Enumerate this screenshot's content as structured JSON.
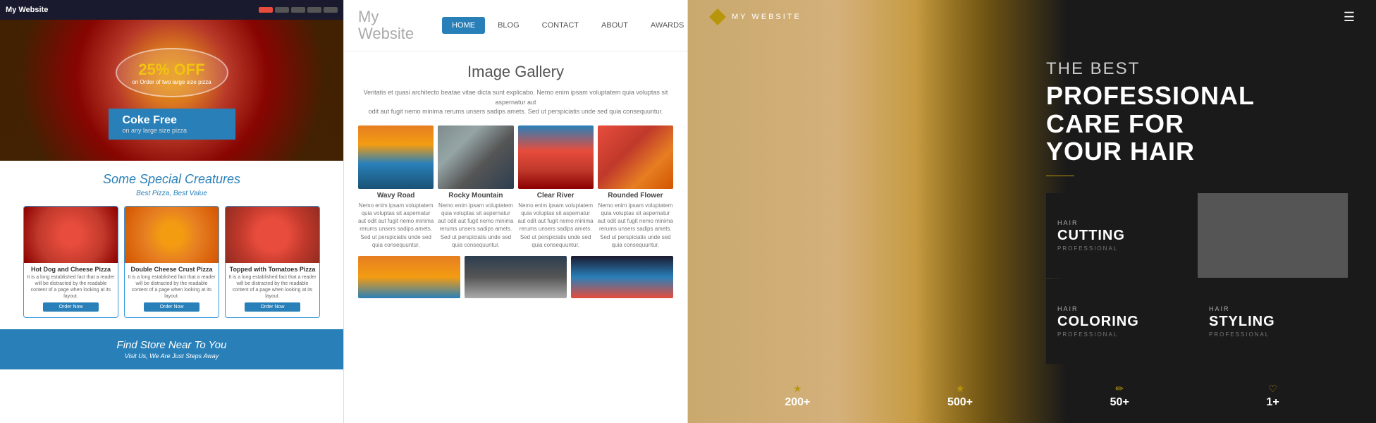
{
  "panel1": {
    "header_title": "My Website",
    "promo_percent": "25% OFF",
    "promo_text": "on Order of two large size pizza",
    "coke_title": "Coke Free",
    "coke_sub": "on any large size pizza",
    "special_title": "Some Special Creatures",
    "special_sub": "Best Pizza, Best Value",
    "cards": [
      {
        "title": "Hot Dog and Cheese Pizza",
        "desc": "It is a long established fact that a reader will be distracted by the readable content of a page when looking at its layout.",
        "btn": "Order Now"
      },
      {
        "title": "Double Cheese Crust Pizza",
        "desc": "It is a long established fact that a reader will be distracted by the readable content of a page when looking at its layout.",
        "btn": "Order Now"
      },
      {
        "title": "Topped with Tomatoes Pizza",
        "desc": "It is a long established fact that a reader will be distracted by the readable content of a page when looking at its layout.",
        "btn": "Order Now"
      }
    ],
    "footer_title": "Find Store Near To You",
    "footer_sub": "Visit Us, We Are Just Steps Away"
  },
  "panel2": {
    "logo": "My\nWebsite",
    "nav": [
      "HOME",
      "BLOG",
      "CONTACT",
      "ABOUT",
      "AWARDS"
    ],
    "active_nav": "HOME",
    "gallery_title": "Image Gallery",
    "gallery_desc": "Veritatis et quasi architecto beatae vitae dicta sunt explicabo. Nemo enim ipsam voluptatem quia voluptas sit aspernatur aut\nodit aut fugit nemo minima rerums unsers sadips amets. Sed ut perspiciatis unde sed quia consequuntur.",
    "images": [
      {
        "label": "Wavy Road",
        "desc": "Nemo enim ipsam voluptatem quia voluptas sit aspernatur aut odit aut fugit nemo minima rerums unsers sadips amets. Sed ut perspiciatis unde sed quia consequuntur."
      },
      {
        "label": "Rocky Mountain",
        "desc": "Nemo enim ipsam voluptatem quia voluptas sit aspernatur aut odit aut fugit nemo minima rerums unsers sadips amets. Sed ut perspiciatis unde sed quia consequuntur."
      },
      {
        "label": "Clear River",
        "desc": "Nemo enim ipsam voluptatem quia voluptas sit aspernatur aut odit aut fugit nemo minima rerums unsers sadips amets. Sed ut perspiciatis unde sed quia consequuntur."
      },
      {
        "label": "Rounded Flower",
        "desc": "Nemo enim ipsam voluptatem quia voluptas sit aspernatur aut odit aut fugit nemo minima rerums unsers sadips amets. Sed ut perspiciatis unde sed quia consequuntur."
      }
    ]
  },
  "panel3": {
    "logo_text": "MY WEBSITE",
    "tagline_light": "THE BEST",
    "tagline_bold1": "PROFESSIONAL",
    "tagline_bold2": "CARE FOR",
    "tagline_bold3": "YOUR HAIR",
    "services": [
      {
        "label": "HAIR",
        "title": "CUTTING",
        "sub": "PROFESSIONAL"
      },
      {
        "label": "HAIR",
        "title": "COLORING",
        "sub": "PROFESSIONAL"
      },
      {
        "label": "HAIR",
        "title": "STYLING",
        "sub": "PROFESSIONAL"
      }
    ],
    "stats": [
      {
        "num": "200+",
        "label": ""
      },
      {
        "num": "500+",
        "label": ""
      },
      {
        "num": "50+",
        "label": ""
      },
      {
        "num": "1+",
        "label": ""
      }
    ]
  }
}
